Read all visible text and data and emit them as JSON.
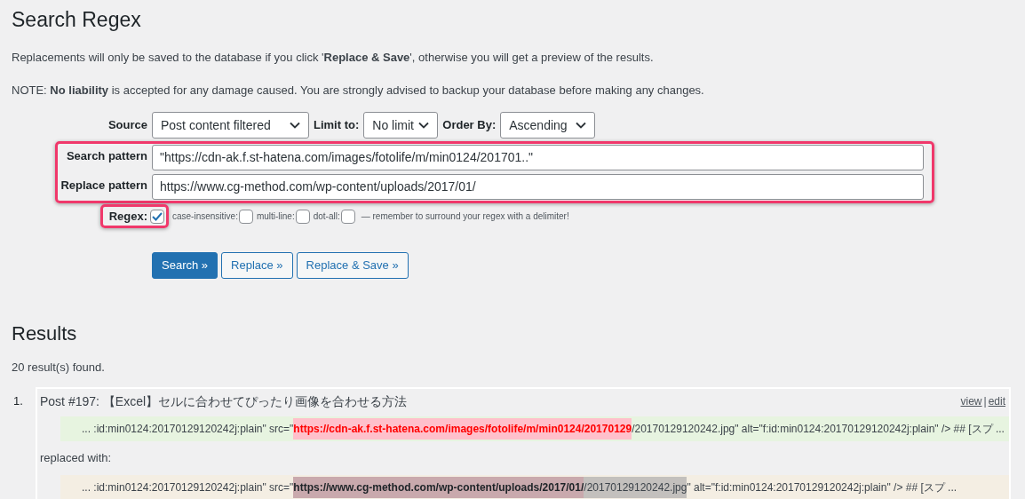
{
  "title": "Search Regex",
  "notices": [
    "Replacements will only be saved to the database if you click '**Replace & Save**', otherwise you will get a preview of the results.",
    "NOTE: **No liability** is accepted for any damage caused. You are strongly advised to backup your database before making any changes."
  ],
  "form": {
    "source": {
      "label": "Source",
      "value": "Post content filtered"
    },
    "limit": {
      "label": "Limit to:",
      "value": "No limit"
    },
    "order": {
      "label": "Order By:",
      "value": "Ascending"
    },
    "search_pattern": {
      "label": "Search pattern",
      "value": "\"https://cdn-ak.f.st-hatena.com/images/fotolife/m/min0124/201701..\""
    },
    "replace_pattern": {
      "label": "Replace pattern",
      "value": "https://www.cg-method.com/wp-content/uploads/2017/01/"
    },
    "regex": {
      "label": "Regex:",
      "checked": true
    },
    "options": [
      {
        "label": "case-insensitive:",
        "checked": false
      },
      {
        "label": "multi-line:",
        "checked": false
      },
      {
        "label": "dot-all:",
        "checked": false
      }
    ],
    "hint": "— remember to surround your regex with a delimiter!",
    "buttons": [
      {
        "label": "Search »",
        "primary": true
      },
      {
        "label": "Replace »",
        "primary": false
      },
      {
        "label": "Replace & Save »",
        "primary": false
      }
    ]
  },
  "results": {
    "heading": "Results",
    "count": "20 result(s) found.",
    "items": [
      {
        "number": "1.",
        "title": "Post #197: 【Excel】セルに合わせてぴったり画像を合わせる方法",
        "links": [
          "view",
          "edit"
        ],
        "link_separator": "|",
        "original": [
          {
            "kind": "plain",
            "text": "... :id:min0124:20170129120242j:plain\" src=\""
          },
          {
            "kind": "match",
            "text": "https://cdn-ak.f.st-hatena.com/images/fotolife/m/min0124/20170129"
          },
          {
            "kind": "plain",
            "text": "/20170129120242.jpg\" alt=\"f:id:min0124:20170129120242j:plain\" /> ## [スプ ..."
          }
        ],
        "replaced_label": "replaced with:",
        "replaced": [
          {
            "kind": "plain",
            "text": "... :id:min0124:20170129120242j:plain\" src=\""
          },
          {
            "kind": "replacement",
            "text": "https://www.cg-method.com/wp-content/uploads/2017/01/"
          },
          {
            "kind": "residual",
            "text": "/20170129120242.jpg"
          },
          {
            "kind": "plain",
            "text": "\" alt=\"f:id:min0124:20170129120242j:plain\" /> ## [スプ ..."
          }
        ]
      }
    ]
  }
}
